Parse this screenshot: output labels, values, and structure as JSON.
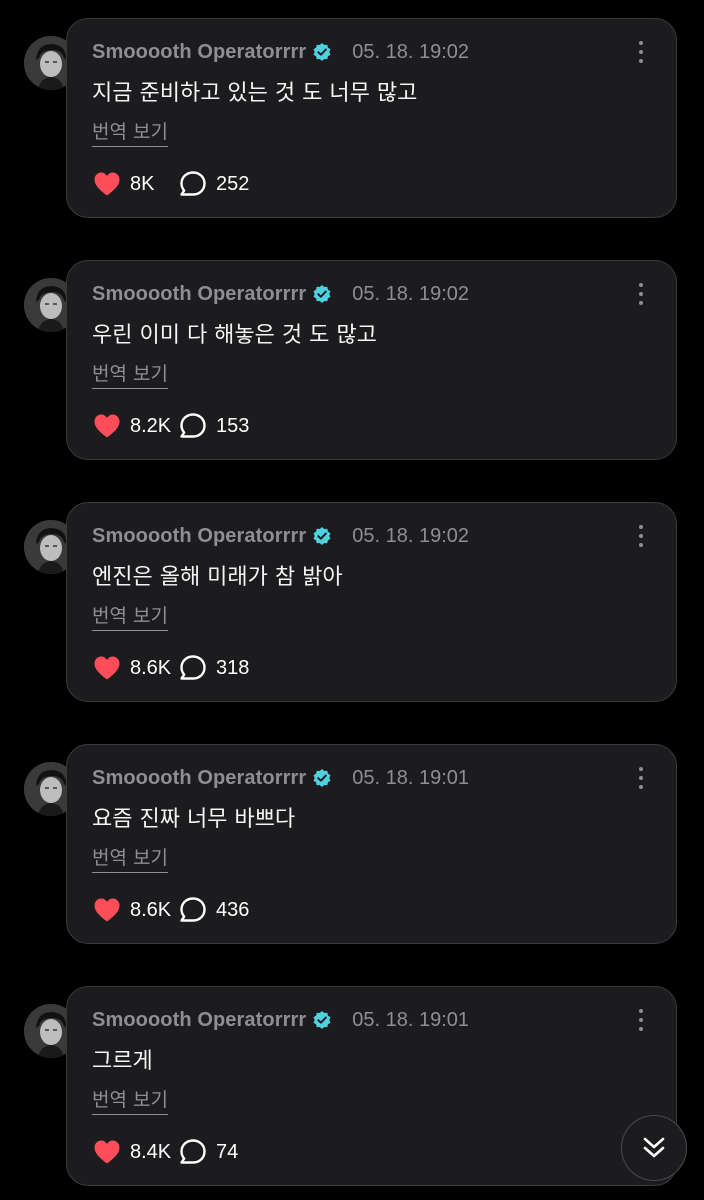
{
  "posts": [
    {
      "author": "Smooooth Operatorrrr",
      "time": "05. 18. 19:02",
      "text": "지금 준비하고 있는 것 도 너무 많고",
      "translate": "번역 보기",
      "likes": "8K",
      "comments": "252"
    },
    {
      "author": "Smooooth Operatorrrr",
      "time": "05. 18. 19:02",
      "text": "우린 이미 다 해놓은 것 도 많고",
      "translate": "번역 보기",
      "likes": "8.2K",
      "comments": "153"
    },
    {
      "author": "Smooooth Operatorrrr",
      "time": "05. 18. 19:02",
      "text": "엔진은 올해 미래가 참 밝아",
      "translate": "번역 보기",
      "likes": "8.6K",
      "comments": "318"
    },
    {
      "author": "Smooooth Operatorrrr",
      "time": "05. 18. 19:01",
      "text": "요즘 진짜 너무 바쁘다",
      "translate": "번역 보기",
      "likes": "8.6K",
      "comments": "436"
    },
    {
      "author": "Smooooth Operatorrrr",
      "time": "05. 18. 19:01",
      "text": "그르게",
      "translate": "번역 보기",
      "likes": "8.4K",
      "comments": "74"
    }
  ],
  "icons": {
    "verified": "verified-badge-icon",
    "like": "heart-icon",
    "comment": "comment-bubble-icon",
    "more": "more-vertical-icon",
    "scroll": "chevron-double-down-icon"
  },
  "colors": {
    "background": "#000000",
    "bubble": "#1c1c1e",
    "bubble_border": "#3a3a3d",
    "muted_text": "#8e8e93",
    "verified": "#4fd1e0",
    "heart": "#ff4d5a"
  }
}
